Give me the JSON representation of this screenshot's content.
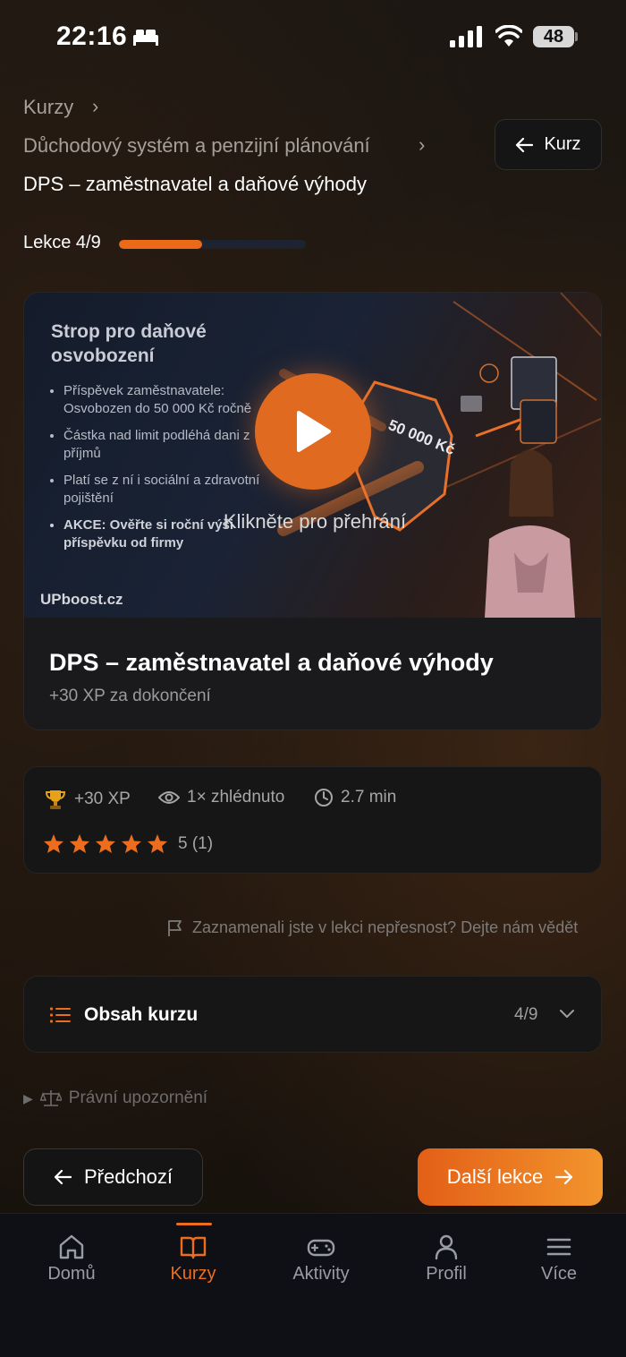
{
  "status_bar": {
    "time": "22:16",
    "battery": "48"
  },
  "breadcrumb": {
    "items": [
      "Kurzy",
      "Důchodový systém a penzijní plánování"
    ],
    "current": "DPS – zaměstnavatel a daňové výhody",
    "back_label": "Kurz"
  },
  "progress": {
    "label": "Lekce 4/9",
    "fraction": 0.444
  },
  "video": {
    "slide_title": "Strop pro daňové osvobození",
    "bullets": [
      "Příspěvek zaměstnavatele: Osvobozen do 50 000 Kč ročně",
      "Částka nad limit podléhá dani z příjmů",
      "Platí se z ní i sociální a zdravotní pojištění",
      "AKCE: Ověřte si roční výši příspěvku od firmy"
    ],
    "shield_text": "50 000 Kč",
    "brand": "UPboost.cz",
    "play_caption": "Klikněte pro přehrání"
  },
  "lesson": {
    "title": "DPS – zaměstnavatel a daňové výhody",
    "subtitle": "+30 XP za dokončení"
  },
  "stats": {
    "xp": "+30 XP",
    "views": "1× zhlédnuto",
    "duration": "2.7 min",
    "rating": "5 (1)",
    "stars": 5
  },
  "report_text": "Zaznamenali jste v lekci nepřesnost? Dejte nám vědět",
  "toc": {
    "title": "Obsah kurzu",
    "count": "4/9"
  },
  "legal": "Právní upozornění",
  "nav": {
    "prev": "Předchozí",
    "next": "Další lekce"
  },
  "tabbar": {
    "items": [
      "Domů",
      "Kurzy",
      "Aktivity",
      "Profil",
      "Více"
    ],
    "active": "Kurzy"
  },
  "colors": {
    "accent": "#ec6d1d",
    "background": "#1c1712",
    "card": "#161616"
  }
}
